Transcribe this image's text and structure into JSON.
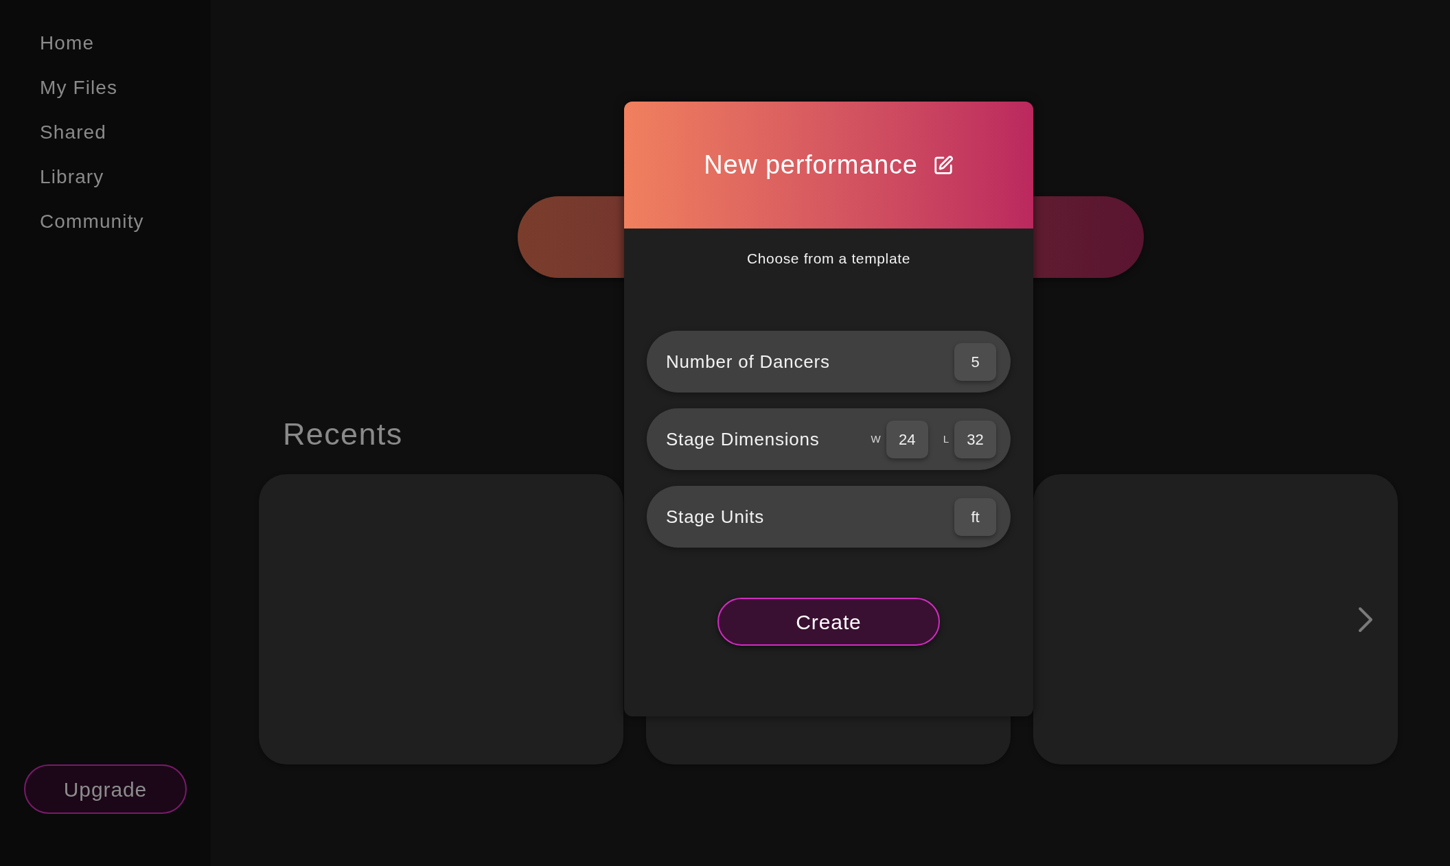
{
  "sidebar": {
    "items": [
      {
        "label": "Home"
      },
      {
        "label": "My Files"
      },
      {
        "label": "Shared"
      },
      {
        "label": "Library"
      },
      {
        "label": "Community"
      }
    ],
    "upgrade_button": "Upgrade"
  },
  "recents": {
    "title": "Recents"
  },
  "modal": {
    "title": "New performance",
    "subtitle": "Choose from a template",
    "fields": [
      {
        "kind": "single",
        "label": "Number of Dancers",
        "value": "5"
      },
      {
        "kind": "pair",
        "label": "Stage Dimensions",
        "inputs": [
          {
            "label": "W",
            "value": "24"
          },
          {
            "label": "L",
            "value": "32"
          }
        ]
      },
      {
        "kind": "single",
        "label": "Stage Units",
        "value": "ft"
      }
    ],
    "create_button": "Create"
  }
}
